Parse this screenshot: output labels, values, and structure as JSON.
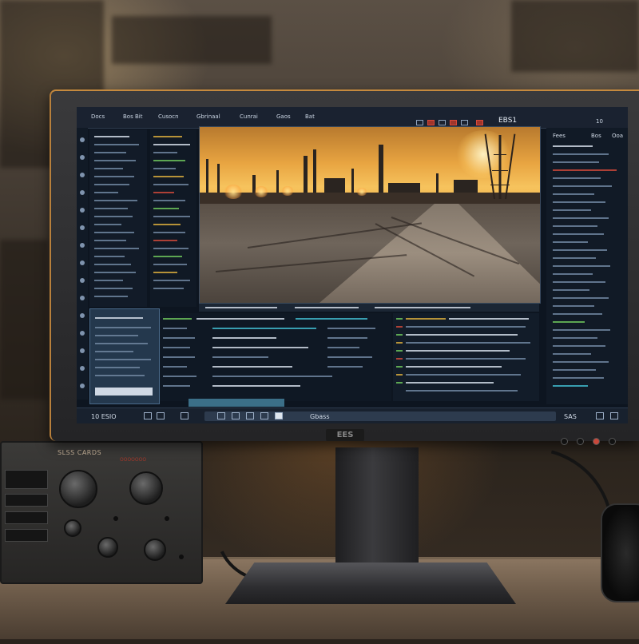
{
  "device": {
    "label": "SLSS CARDS",
    "sublabel": "OOOOOOO"
  },
  "monitor": {
    "brand_logo": "EES"
  },
  "screen": {
    "menu": {
      "items": [
        "Docs",
        "Bos Bit",
        "Cusocn",
        "Gbrinaal",
        "Cunrai",
        "Gaos",
        "Bat"
      ],
      "right_label": "EBS1",
      "far_right": "10"
    },
    "right_panel": {
      "headers": [
        "Fees",
        "Bos",
        "Ooa"
      ]
    },
    "status": {
      "left_label": "10 ESIO",
      "center_label": "Gbass",
      "right_label": "SAS"
    }
  }
}
